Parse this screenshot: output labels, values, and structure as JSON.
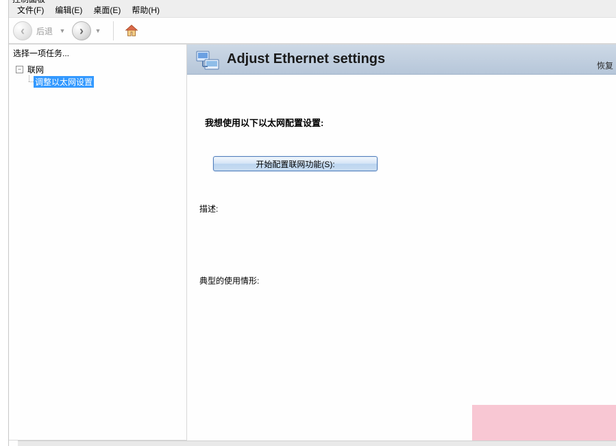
{
  "window": {
    "title_fragment": "控制面板"
  },
  "menu": {
    "file": "文件(F)",
    "edit": "编辑(E)",
    "desktop": "桌面(E)",
    "help": "帮助(H)"
  },
  "toolbar": {
    "back_label": "后退"
  },
  "sidebar": {
    "header": "选择一项任务...",
    "root": "联网",
    "child": "调整以太网设置"
  },
  "content": {
    "title": "Adjust Ethernet settings",
    "restore": "恢复",
    "section_label": "我想使用以下以太网配置设置:",
    "config_button": "开始配置联网功能(S):",
    "desc_label": "描述:",
    "usage_label": "典型的使用情形:"
  }
}
